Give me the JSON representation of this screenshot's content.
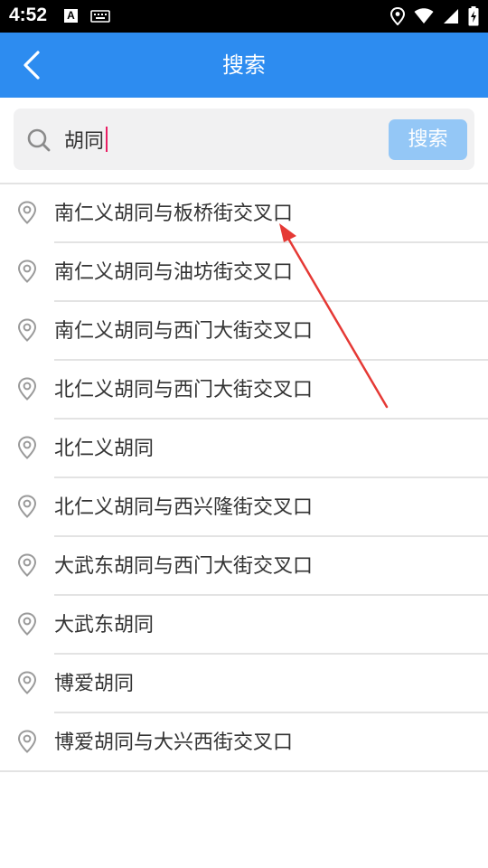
{
  "status_bar": {
    "time": "4:52",
    "a_badge": "A"
  },
  "app_bar": {
    "title": "搜索"
  },
  "search": {
    "value": "胡同",
    "button_label": "搜索"
  },
  "results": [
    {
      "label": "南仁义胡同与板桥街交叉口"
    },
    {
      "label": "南仁义胡同与油坊街交叉口"
    },
    {
      "label": "南仁义胡同与西门大街交叉口"
    },
    {
      "label": "北仁义胡同与西门大街交叉口"
    },
    {
      "label": "北仁义胡同"
    },
    {
      "label": "北仁义胡同与西兴隆街交叉口"
    },
    {
      "label": "大武东胡同与西门大街交叉口"
    },
    {
      "label": "大武东胡同"
    },
    {
      "label": "博爱胡同"
    },
    {
      "label": "博爱胡同与大兴西街交叉口"
    }
  ],
  "colors": {
    "app_bar": "#2d8cf0",
    "search_button": "#94c7f6",
    "caret": "#e91e63",
    "annotation_arrow": "#e53935"
  },
  "icons": {
    "back": "chevron-left-icon",
    "search": "search-icon",
    "result": "location-pin-icon"
  }
}
